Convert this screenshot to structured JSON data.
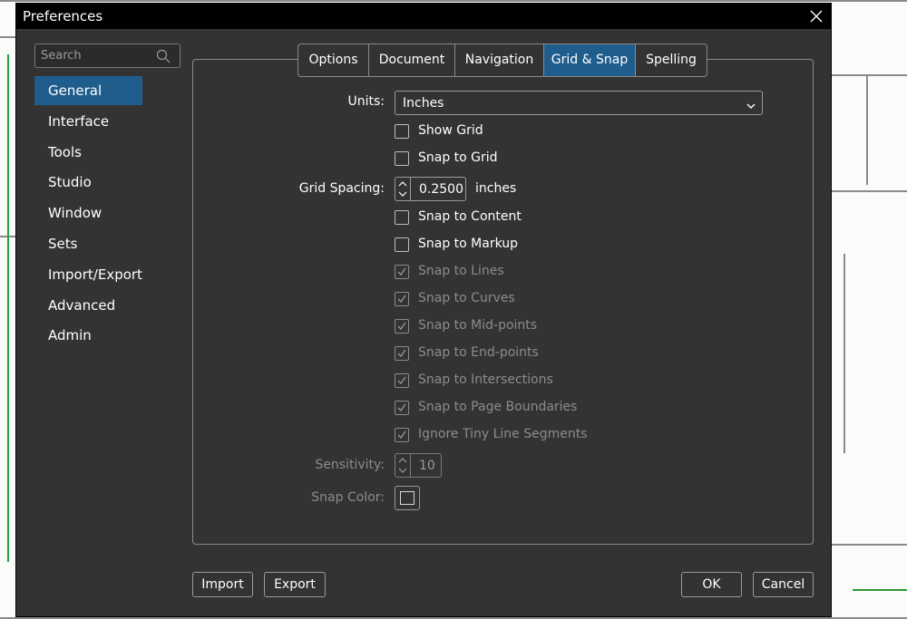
{
  "window": {
    "title": "Preferences"
  },
  "search": {
    "placeholder": "Search"
  },
  "sidebar": {
    "items": [
      {
        "label": "General"
      },
      {
        "label": "Interface"
      },
      {
        "label": "Tools"
      },
      {
        "label": "Studio"
      },
      {
        "label": "Window"
      },
      {
        "label": "Sets"
      },
      {
        "label": "Import/Export"
      },
      {
        "label": "Advanced"
      },
      {
        "label": "Admin"
      }
    ],
    "active": "General"
  },
  "tabs": [
    {
      "label": "Options"
    },
    {
      "label": "Document"
    },
    {
      "label": "Navigation"
    },
    {
      "label": "Grid & Snap"
    },
    {
      "label": "Spelling"
    }
  ],
  "active_tab": "Grid & Snap",
  "form": {
    "units_label": "Units:",
    "units_value": "Inches",
    "show_grid": {
      "label": "Show Grid",
      "checked": false,
      "enabled": true
    },
    "snap_to_grid": {
      "label": "Snap to Grid",
      "checked": false,
      "enabled": true
    },
    "grid_spacing_label": "Grid Spacing:",
    "grid_spacing_value": "0.2500",
    "grid_spacing_unit": "inches",
    "snap_to_content": {
      "label": "Snap to Content",
      "checked": false,
      "enabled": true
    },
    "snap_to_markup": {
      "label": "Snap to Markup",
      "checked": false,
      "enabled": true
    },
    "snap_to_lines": {
      "label": "Snap to Lines",
      "checked": true,
      "enabled": false
    },
    "snap_to_curves": {
      "label": "Snap to Curves",
      "checked": true,
      "enabled": false
    },
    "snap_to_midpoints": {
      "label": "Snap to Mid-points",
      "checked": true,
      "enabled": false
    },
    "snap_to_endpoints": {
      "label": "Snap to End-points",
      "checked": true,
      "enabled": false
    },
    "snap_to_intersections": {
      "label": "Snap to Intersections",
      "checked": true,
      "enabled": false
    },
    "snap_to_page_boundaries": {
      "label": "Snap to Page Boundaries",
      "checked": true,
      "enabled": false
    },
    "ignore_tiny_segments": {
      "label": "Ignore Tiny Line Segments",
      "checked": true,
      "enabled": false
    },
    "sensitivity_label": "Sensitivity:",
    "sensitivity_value": "10",
    "snap_color_label": "Snap Color:"
  },
  "buttons": {
    "import": "Import",
    "export": "Export",
    "ok": "OK",
    "cancel": "Cancel"
  },
  "colors": {
    "accent": "#1f5d8c",
    "dialog_bg": "#333333",
    "titlebar_bg": "#000000"
  }
}
